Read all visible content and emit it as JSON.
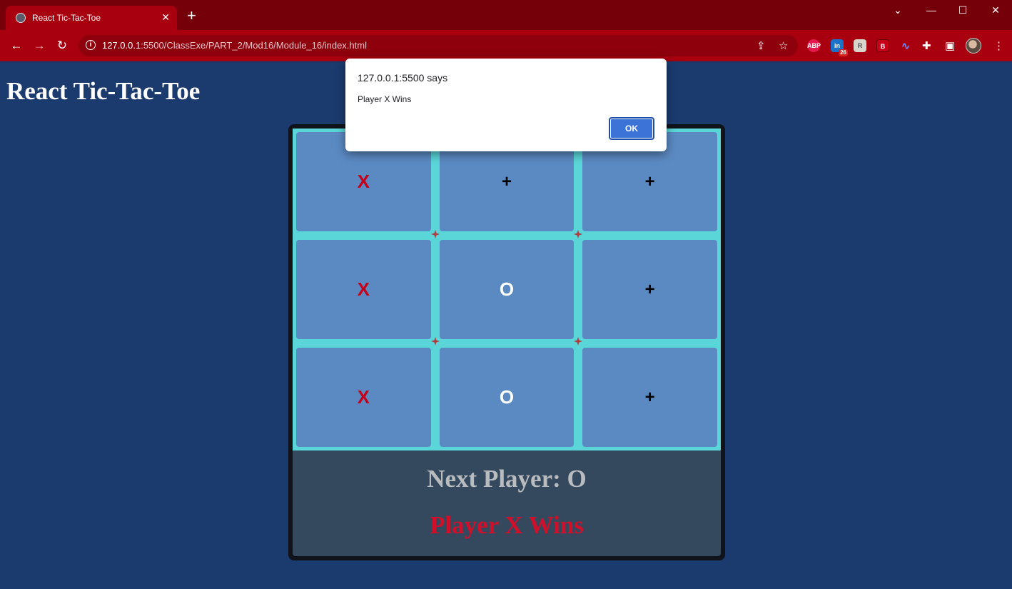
{
  "browser": {
    "tab_title": "React Tic-Tac-Toe",
    "tab_close": "✕",
    "new_tab": "+",
    "url_host": "127.0.0.1",
    "url_rest": ":5500/ClassExe/PART_2/Mod16/Module_16/index.html",
    "window_controls": {
      "menu": "⌄",
      "minimize": "—",
      "maximize": "☐",
      "close": "✕"
    },
    "nav": {
      "back": "←",
      "forward": "→",
      "reload": "↻"
    },
    "extensions": [
      {
        "name": "adblock-plus-icon",
        "label": "ABP",
        "color": "#e4184f"
      },
      {
        "name": "linkedin-extension-icon",
        "label": "in",
        "color": "#1a73c9",
        "badge": "26"
      },
      {
        "name": "extension-r-icon",
        "label": "R",
        "color": "#d9d4cc"
      },
      {
        "name": "extension-b-icon",
        "label": "B",
        "color": "#c8001a"
      },
      {
        "name": "audio-extension-icon",
        "label": "∿",
        "color": "#4a6cf7"
      }
    ],
    "accent_color": "#a8000f"
  },
  "page": {
    "title": "React Tic-Tac-Toe"
  },
  "board": {
    "cells": [
      "X",
      "+",
      "+",
      "X",
      "O",
      "+",
      "X",
      "O",
      "+"
    ],
    "next_player": "Next Player: O",
    "winner": "Player X Wins"
  },
  "dialog": {
    "origin": "127.0.0.1:5500 says",
    "message": "Player X Wins",
    "ok_label": "OK"
  }
}
